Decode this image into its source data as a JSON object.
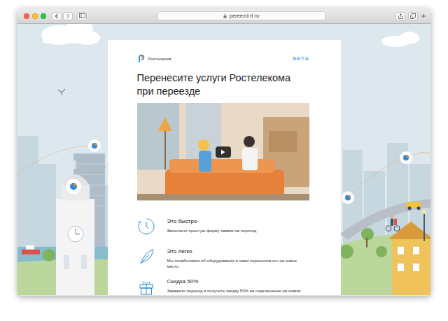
{
  "browser": {
    "lights": [
      {
        "color": "#fd5f57"
      },
      {
        "color": "#febc2e"
      },
      {
        "color": "#2ac840"
      }
    ],
    "address": "pereezd.rt.ru"
  },
  "header": {
    "logo": "Ростелеком",
    "beta": "БЕТА"
  },
  "title": "Перенесите услуги Ростелекома при переезде",
  "features": [
    {
      "title": "Это быстро",
      "description": "Заполните простую форму заявки на переезд"
    },
    {
      "title": "Это легко",
      "description": "Мы позаботимся об оборудовании и сами перенесем его на новое место"
    },
    {
      "title": "Скидка 50%",
      "description": "Закажите переезд и получите скидку 50% на подключение на новом"
    }
  ]
}
